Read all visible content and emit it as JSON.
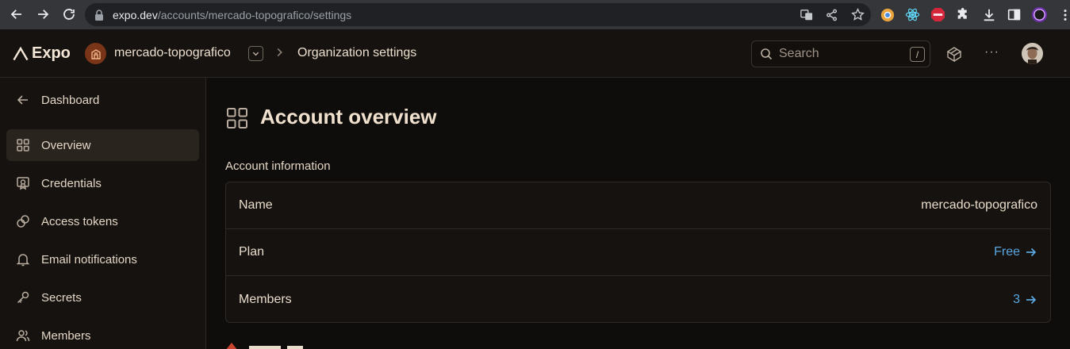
{
  "browser": {
    "url_host": "expo.dev",
    "url_path": "/accounts/mercado-topografico/settings"
  },
  "header": {
    "logo_text": "Expo",
    "org_name": "mercado-topografico",
    "breadcrumb_sep": "›",
    "page": "Organization settings",
    "search_placeholder": "Search",
    "search_shortcut": "/",
    "more": "···"
  },
  "sidebar": {
    "back_label": "Dashboard",
    "items": [
      {
        "label": "Overview",
        "icon": "grid-icon",
        "active": true
      },
      {
        "label": "Credentials",
        "icon": "certificate-icon"
      },
      {
        "label": "Access tokens",
        "icon": "link-icon"
      },
      {
        "label": "Email notifications",
        "icon": "bell-icon"
      },
      {
        "label": "Secrets",
        "icon": "key-icon"
      },
      {
        "label": "Members",
        "icon": "users-icon"
      }
    ]
  },
  "main": {
    "title": "Account overview",
    "section_label": "Account information",
    "rows": [
      {
        "label": "Name",
        "value": "mercado-topografico"
      },
      {
        "label": "Plan",
        "value": "Free"
      },
      {
        "label": "Members",
        "value": "3"
      }
    ]
  },
  "colors": {
    "link": "#5aa7e0",
    "background": "#0f0d0b",
    "surface": "#15120f",
    "active_item": "#2a241f",
    "org_avatar": "#7a3417"
  }
}
